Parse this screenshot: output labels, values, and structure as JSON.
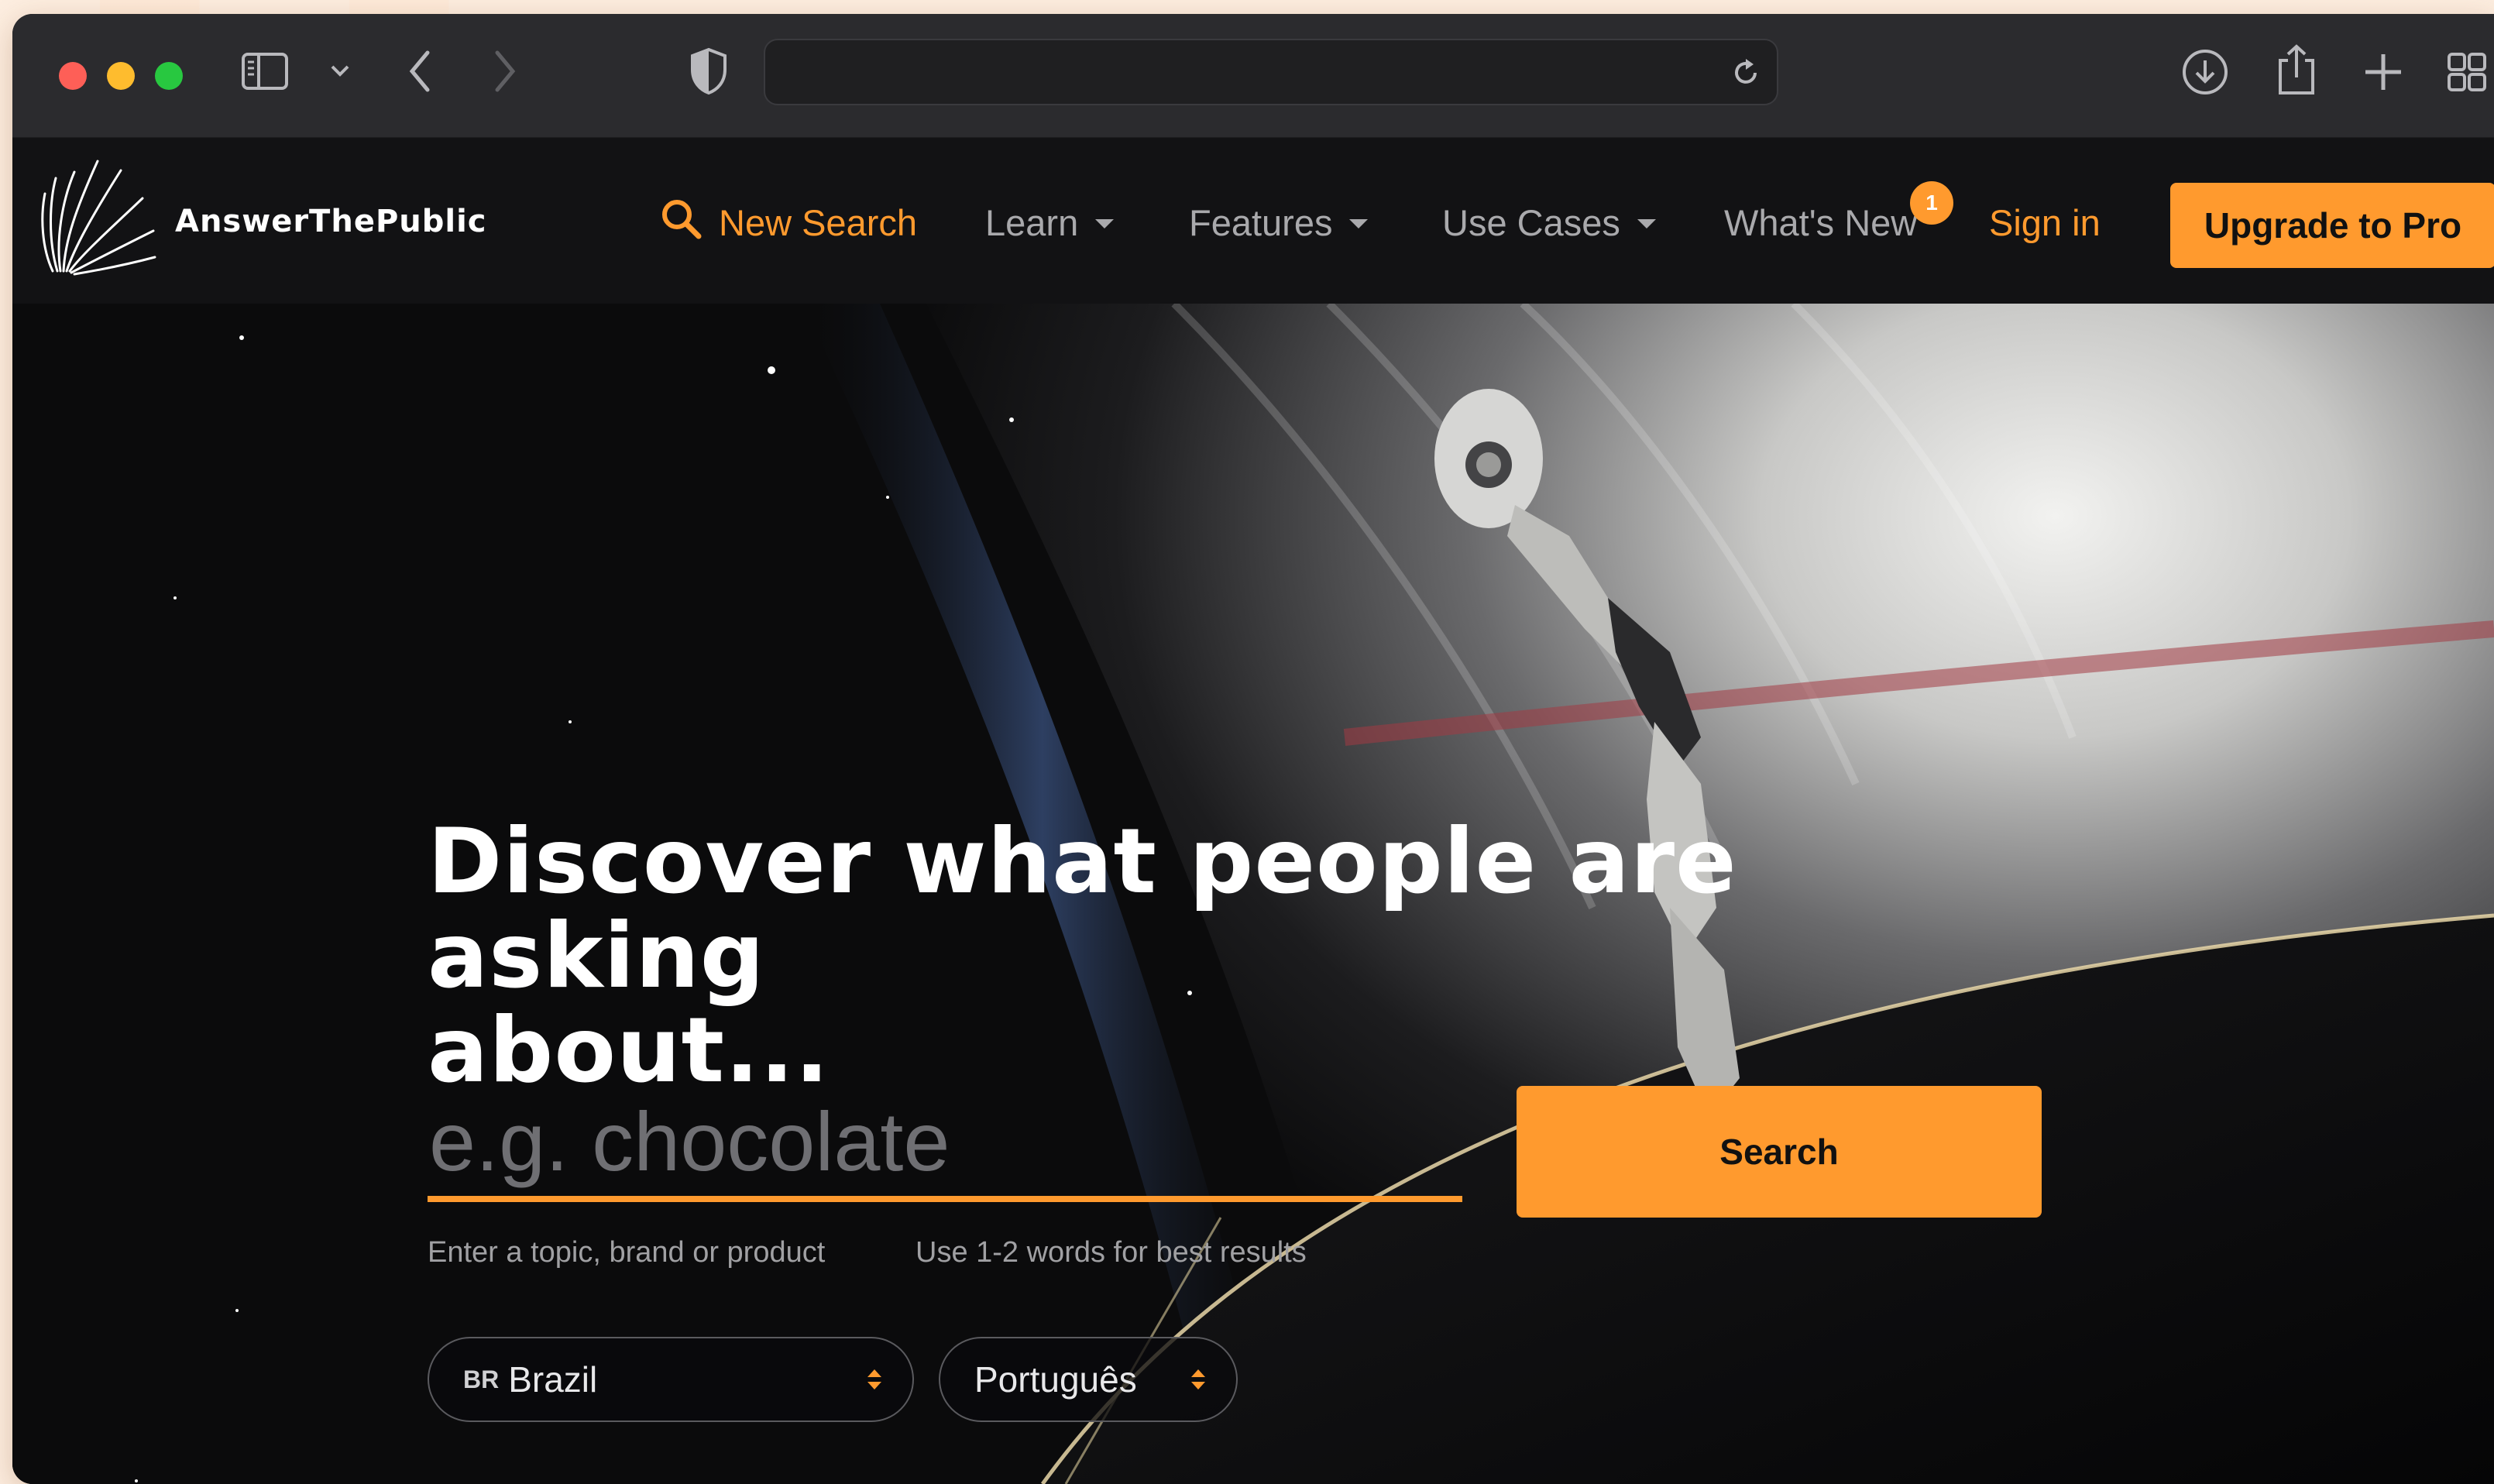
{
  "browser": {
    "address_value": "",
    "icons": [
      "sidebar-icon",
      "chevron-down-icon",
      "back-icon",
      "forward-icon",
      "shield-icon",
      "reload-icon",
      "download-icon",
      "share-icon",
      "new-tab-icon",
      "tab-overview-icon"
    ]
  },
  "nav": {
    "brand": "AnswerThePublic",
    "new_search": "New Search",
    "learn": "Learn",
    "features": "Features",
    "use_cases": "Use Cases",
    "whats_new": "What's New",
    "whats_new_badge": "1",
    "sign_in": "Sign in",
    "upgrade": "Upgrade to Pro"
  },
  "hero": {
    "headline_line1": "Discover what people are asking",
    "headline_line2": "about...",
    "search_placeholder": "e.g. chocolate",
    "search_value": "",
    "search_button": "Search",
    "hint_topic": "Enter a topic, brand or product",
    "hint_words": "Use 1-2 words for best results",
    "country_code": "BR",
    "country": "Brazil",
    "language": "Português"
  },
  "colors": {
    "accent": "#ff9a2e",
    "chrome": "#2b2b2e",
    "nav_bg": "#121214",
    "hero_bg": "#0b0b0c"
  }
}
